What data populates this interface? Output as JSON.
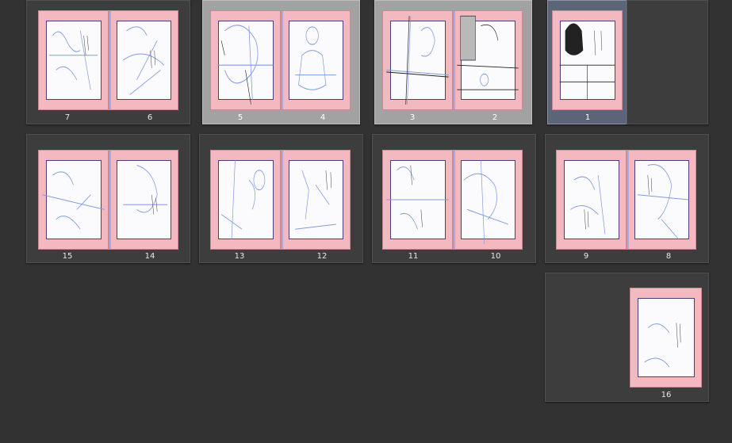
{
  "spreads": [
    {
      "id": "spread-6-7",
      "state": "normal",
      "pages": [
        "7",
        "6"
      ]
    },
    {
      "id": "spread-4-5",
      "state": "selected",
      "pages": [
        "5",
        "4"
      ]
    },
    {
      "id": "spread-2-3",
      "state": "selected",
      "pages": [
        "3",
        "2"
      ]
    },
    {
      "id": "spread-1",
      "state": "active",
      "pages": [
        "1"
      ]
    },
    {
      "id": "spread-14-15",
      "state": "normal",
      "pages": [
        "15",
        "14"
      ]
    },
    {
      "id": "spread-12-13",
      "state": "normal",
      "pages": [
        "13",
        "12"
      ]
    },
    {
      "id": "spread-10-11",
      "state": "normal",
      "pages": [
        "11",
        "10"
      ]
    },
    {
      "id": "spread-8-9",
      "state": "normal",
      "pages": [
        "9",
        "8"
      ]
    },
    {
      "id": "spread-16",
      "state": "normal",
      "pages": [
        "16"
      ]
    }
  ],
  "colors": {
    "background": "#323232",
    "card": "#3d3d3d",
    "card_selected": "#a2a2a2",
    "card_active": "#5c6578",
    "bleed": "#f4b8c0",
    "paper": "#fbfbfd",
    "sketch": "#7f9ae0",
    "ink": "#222222"
  }
}
